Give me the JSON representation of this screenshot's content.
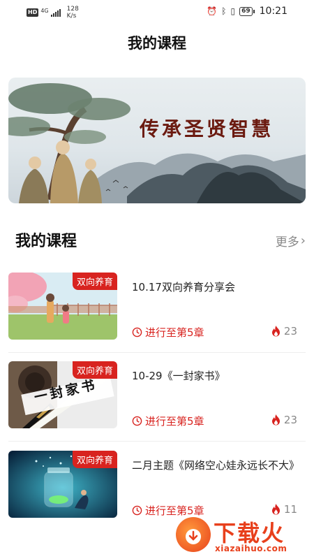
{
  "status_bar": {
    "hd": "HD",
    "network": "4G",
    "speed": "128 K/s",
    "battery": "69",
    "time": "10:21"
  },
  "header": {
    "title": "我的课程"
  },
  "banner": {
    "text": "传承圣贤智慧"
  },
  "section": {
    "title": "我的课程",
    "more": "更多"
  },
  "courses": [
    {
      "tag": "双向养育",
      "name": "10.17双向养育分享会",
      "progress": "进行至第5章",
      "count": "23"
    },
    {
      "tag": "双向养育",
      "name": "10-29《一封家书》",
      "progress": "进行至第5章",
      "count": "23"
    },
    {
      "tag": "双向养育",
      "name": "二月主题《网络空心娃永远长不大》",
      "progress": "进行至第5章",
      "count": "11"
    }
  ],
  "thumb_text": {
    "letter": "一封家书"
  },
  "watermark": {
    "title": "下载火",
    "sub": "xiazaihuo.com"
  },
  "colors": {
    "accent": "#d8231f",
    "muted": "#888888",
    "watermark": "#e8401c"
  }
}
